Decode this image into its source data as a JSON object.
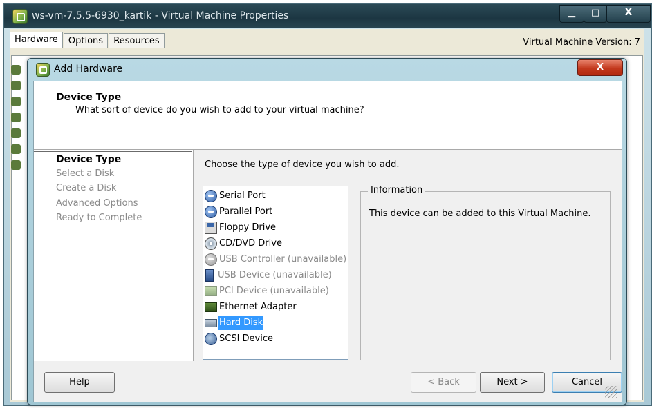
{
  "outer_window": {
    "title": "ws-vm-7.5.5-6930_kartik - Virtual Machine Properties",
    "minimize_glyph": "▁",
    "maximize_glyph": "□",
    "close_glyph": "X",
    "tabs": [
      "Hardware",
      "Options",
      "Resources"
    ],
    "vm_version": "Virtual Machine Version: 7"
  },
  "dialog": {
    "title": "Add Hardware",
    "close_glyph": "X",
    "header": {
      "title": "Device Type",
      "subtitle": "What sort of device do you wish to add to your virtual machine?"
    },
    "steps": [
      "Device Type",
      "Select a Disk",
      "Create a Disk",
      "Advanced Options",
      "Ready to Complete"
    ],
    "active_step": "Device Type",
    "prompt": "Choose the type of device you wish to add.",
    "devices": [
      {
        "label": "Serial Port",
        "icon": "serial-port-icon",
        "state": "available"
      },
      {
        "label": "Parallel Port",
        "icon": "parallel-port-icon",
        "state": "available"
      },
      {
        "label": "Floppy Drive",
        "icon": "floppy-drive-icon",
        "state": "available"
      },
      {
        "label": "CD/DVD Drive",
        "icon": "cd-dvd-icon",
        "state": "available"
      },
      {
        "label": "USB Controller (unavailable)",
        "icon": "usb-controller-icon",
        "state": "unavailable"
      },
      {
        "label": "USB Device (unavailable)",
        "icon": "usb-device-icon",
        "state": "unavailable"
      },
      {
        "label": "PCI Device (unavailable)",
        "icon": "pci-device-icon",
        "state": "unavailable"
      },
      {
        "label": "Ethernet Adapter",
        "icon": "ethernet-adapter-icon",
        "state": "available"
      },
      {
        "label": "Hard Disk",
        "icon": "hard-disk-icon",
        "state": "selected"
      },
      {
        "label": "SCSI Device",
        "icon": "scsi-device-icon",
        "state": "available"
      }
    ],
    "information": {
      "legend": "Information",
      "text": "This device can be added to this Virtual Machine."
    },
    "buttons": {
      "help": "Help",
      "back": "< Back",
      "next": "Next >",
      "cancel": "Cancel"
    }
  },
  "colors": {
    "selection": "#3399ff",
    "dialog_frame": "#a9cfdc",
    "close_button": "#c3391d"
  }
}
